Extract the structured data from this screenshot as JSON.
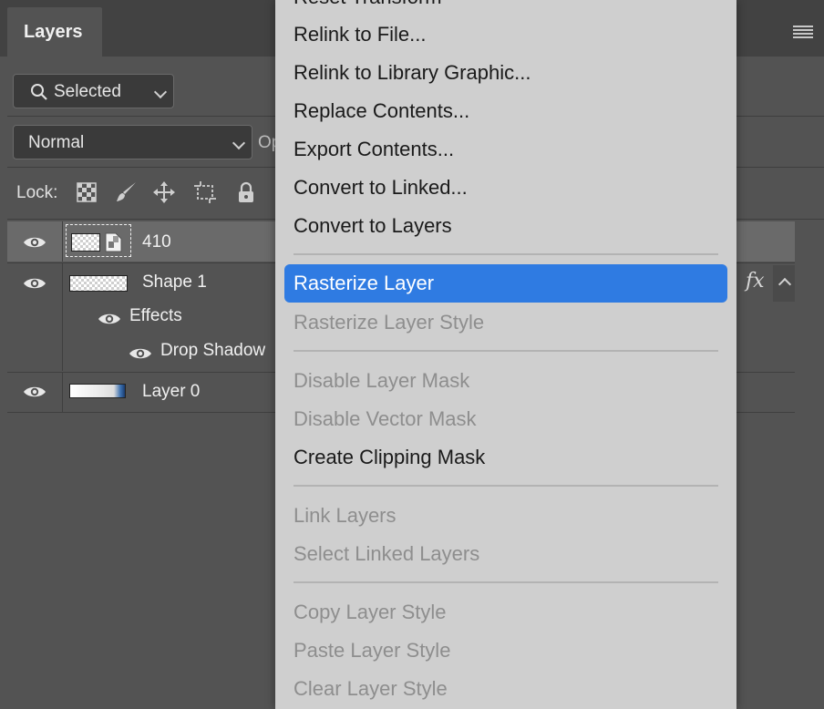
{
  "panel": {
    "tab_label": "Layers",
    "filter": {
      "selected_value": "Selected"
    },
    "blend_mode": {
      "selected_value": "Normal"
    },
    "opacity_label_partial": "Op",
    "lock_label": "Lock:",
    "lock_icons": [
      "lock-transparent-pixels-icon",
      "lock-image-pixels-icon",
      "lock-position-icon",
      "lock-artboard-icon",
      "lock-all-icon"
    ]
  },
  "layers": [
    {
      "name": "410",
      "selected": true,
      "fx": false
    },
    {
      "name": "Shape 1",
      "selected": false,
      "fx": true,
      "fx_label": "fx",
      "effects_label": "Effects",
      "effects": [
        {
          "name": "Drop Shadow"
        }
      ]
    },
    {
      "name": "Layer 0",
      "selected": false,
      "fx": false
    }
  ],
  "menu": {
    "partial_top_item": "Reset Transform",
    "items": [
      {
        "label": "Relink to File...",
        "enabled": true
      },
      {
        "label": "Relink to Library Graphic...",
        "enabled": true
      },
      {
        "label": "Replace Contents...",
        "enabled": true
      },
      {
        "label": "Export Contents...",
        "enabled": true
      },
      {
        "label": "Convert to Linked...",
        "enabled": true
      },
      {
        "label": "Convert to Layers",
        "enabled": true
      },
      {
        "label": "Rasterize Layer",
        "enabled": true,
        "highlighted": true
      },
      {
        "label": "Rasterize Layer Style",
        "enabled": false
      },
      {
        "label": "Disable Layer Mask",
        "enabled": false
      },
      {
        "label": "Disable Vector Mask",
        "enabled": false
      },
      {
        "label": "Create Clipping Mask",
        "enabled": true
      },
      {
        "label": "Link Layers",
        "enabled": false
      },
      {
        "label": "Select Linked Layers",
        "enabled": false
      },
      {
        "label": "Copy Layer Style",
        "enabled": false
      },
      {
        "label": "Paste Layer Style",
        "enabled": false
      },
      {
        "label": "Clear Layer Style",
        "enabled": false
      }
    ]
  },
  "colors": {
    "highlight": "#2f7be2",
    "panel_bg": "#535353",
    "menu_bg": "#cfcfcf",
    "disabled_text": "#8e8e8e"
  }
}
